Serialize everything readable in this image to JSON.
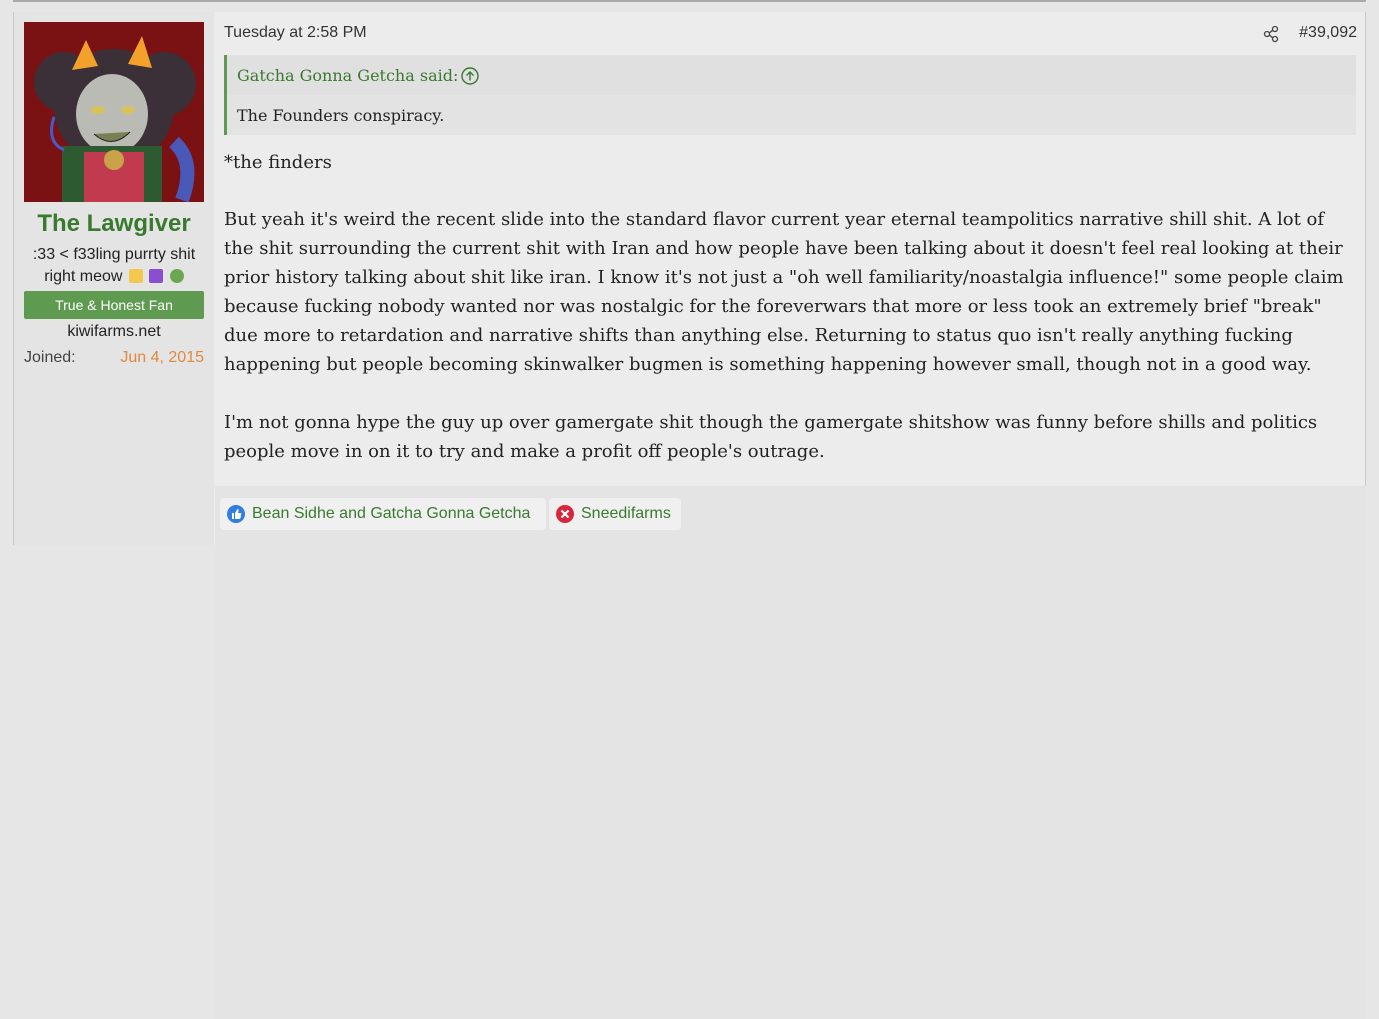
{
  "user": {
    "username": "The Lawgiver",
    "title_line1": ":33 < f33ling purrty shit",
    "title_line2": "right meow",
    "banner": "True & Honest Fan",
    "site": "kiwifarms.net",
    "joined_label": "Joined:",
    "joined_date": "Jun 4, 2015"
  },
  "post": {
    "date": "Tuesday at 2:58 PM",
    "number": "#39,092",
    "share_icon": "share-icon",
    "quote": {
      "author": "Gatcha Gonna Getcha said:",
      "text": "The Founders conspiracy."
    },
    "paragraphs": [
      "*the finders",
      "But yeah it's weird the recent slide into the standard flavor current year eternal teampolitics narrative shill shit. A lot of the shit surrounding the current shit with Iran and how people have been talking about it doesn't feel real looking at their prior history talking about shit like iran. I know it's not just a \"oh well familiarity/noastalgia influence!\" some people claim because fucking nobody wanted nor was nostalgic for the foreverwars that more or less took an extremely brief \"break\" due more to retardation and narrative shifts than anything else. Returning to status quo isn't really anything fucking happening but people becoming skinwalker bugmen is something happening however small, though not in a good way.",
      "I'm not gonna hype the guy up over gamergate shit though the gamergate shitshow was funny before shills and politics people move in on it to try and make a profit off people's outrage."
    ]
  },
  "reactions": [
    {
      "icon": "like-icon",
      "label": "Bean Sidhe and Gatcha Gonna Getcha"
    },
    {
      "icon": "disagree-icon",
      "label": "Sneedifarms"
    }
  ],
  "colors": {
    "accent_green": "#3a7a2f",
    "banner_green": "#5e9a50",
    "joined_orange": "#e08a3c",
    "like_blue": "#2f7ee0",
    "disagree_red": "#d7263d"
  }
}
